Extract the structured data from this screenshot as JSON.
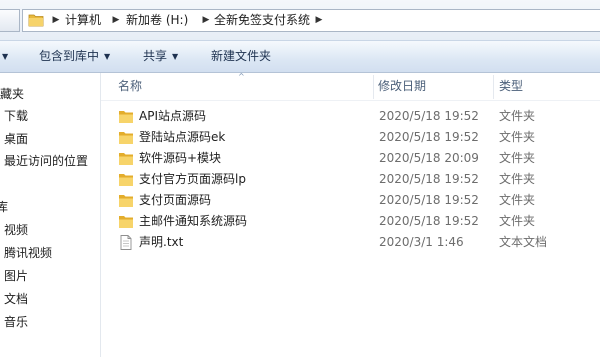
{
  "address": {
    "crumbs": [
      "计算机",
      "新加卷 (H:)",
      "全新免签支付系统"
    ]
  },
  "toolbar": {
    "include_in_library": "包含到库中",
    "share": "共享",
    "new_folder": "新建文件夹"
  },
  "nav": {
    "favorites": "收藏夹",
    "downloads": "下载",
    "desktop": "桌面",
    "recent": "最近访问的位置",
    "libraries": "库",
    "videos": "视频",
    "tencent_video": "腾讯视频",
    "pictures": "图片",
    "documents": "文档",
    "music": "音乐"
  },
  "columns": {
    "name": "名称",
    "date": "修改日期",
    "type": "类型"
  },
  "files": [
    {
      "name": "API站点源码",
      "date": "2020/5/18 19:52",
      "type": "文件夹",
      "icon": "folder-icon"
    },
    {
      "name": "登陆站点源码ek",
      "date": "2020/5/18 19:52",
      "type": "文件夹",
      "icon": "folder-icon"
    },
    {
      "name": "软件源码+模块",
      "date": "2020/5/18 20:09",
      "type": "文件夹",
      "icon": "folder-icon"
    },
    {
      "name": "支付官方页面源码lp",
      "date": "2020/5/18 19:52",
      "type": "文件夹",
      "icon": "folder-icon"
    },
    {
      "name": "支付页面源码",
      "date": "2020/5/18 19:52",
      "type": "文件夹",
      "icon": "folder-icon"
    },
    {
      "name": "主邮件通知系统源码",
      "date": "2020/5/18 19:52",
      "type": "文件夹",
      "icon": "folder-icon"
    },
    {
      "name": "声明.txt",
      "date": "2020/3/1 1:46",
      "type": "文本文档",
      "icon": "text-file-icon"
    }
  ]
}
